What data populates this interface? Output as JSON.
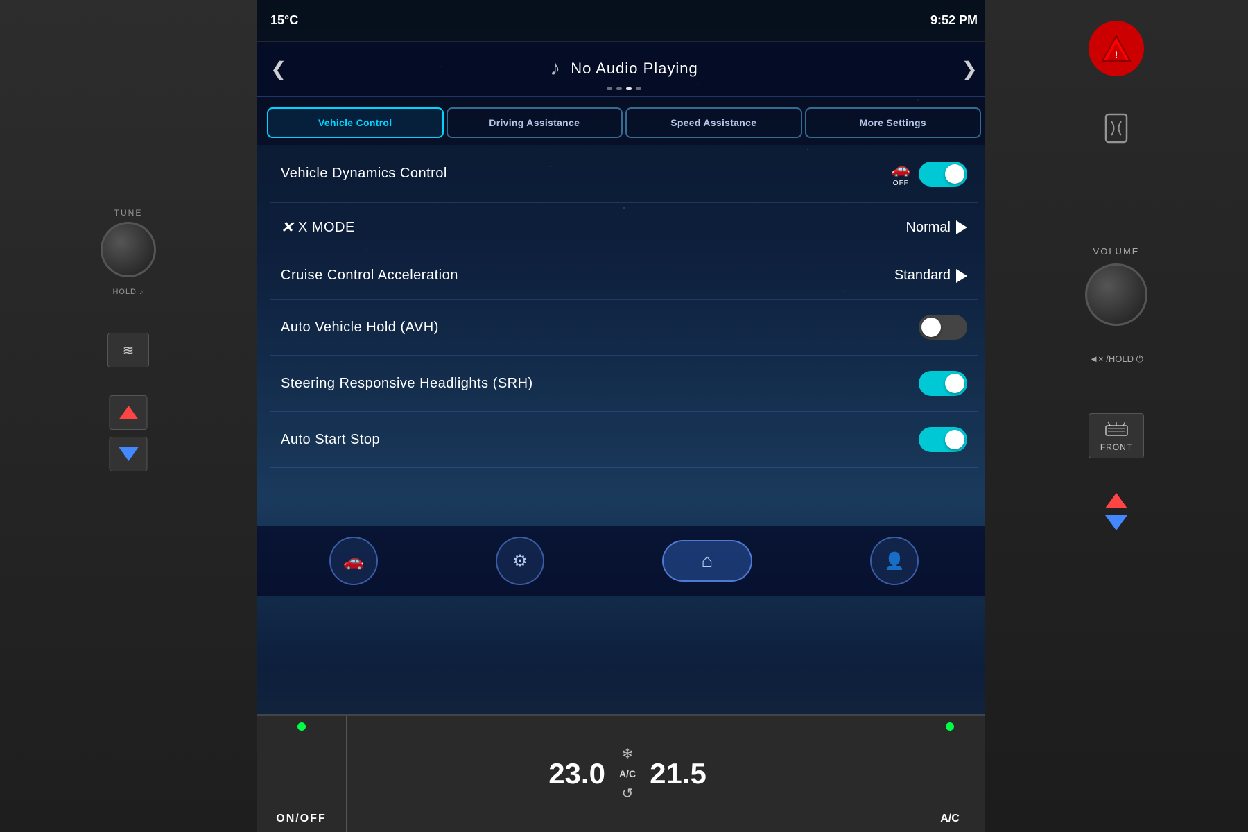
{
  "screen": {
    "status_bar": {
      "temp": "15°C",
      "time": "9:52 PM"
    },
    "audio": {
      "prev_label": "❮",
      "next_label": "❯",
      "title": "No Audio Playing",
      "dots": [
        false,
        false,
        true,
        false
      ]
    },
    "tabs": [
      {
        "id": "vehicle-control",
        "label": "Vehicle Control",
        "active": true
      },
      {
        "id": "driving-assistance",
        "label": "Driving Assistance",
        "active": false
      },
      {
        "id": "speed-assistance",
        "label": "Speed Assistance",
        "active": false
      },
      {
        "id": "more-settings",
        "label": "More Settings",
        "active": false
      }
    ],
    "settings": [
      {
        "id": "vehicle-dynamics-control",
        "label": "Vehicle Dynamics Control",
        "type": "toggle",
        "value": true,
        "has_icon": true
      },
      {
        "id": "xmode",
        "label": "X MODE",
        "type": "selector",
        "value": "Normal",
        "has_xicon": true
      },
      {
        "id": "cruise-control-acceleration",
        "label": "Cruise Control Acceleration",
        "type": "selector",
        "value": "Standard"
      },
      {
        "id": "auto-vehicle-hold",
        "label": "Auto Vehicle Hold (AVH)",
        "type": "toggle",
        "value": false
      },
      {
        "id": "steering-responsive-headlights",
        "label": "Steering Responsive Headlights (SRH)",
        "type": "toggle",
        "value": true
      },
      {
        "id": "auto-start-stop",
        "label": "Auto Start Stop",
        "type": "toggle",
        "value": true
      }
    ],
    "bottom_nav": {
      "car_icon": "🚗",
      "settings_icon": "⚙",
      "home_icon": "⌂",
      "profile_icon": "👤"
    },
    "climate": {
      "onoff_label": "ON/OFF",
      "temp_left": "23.0",
      "ac_label": "A/C",
      "temp_right": "21.5",
      "ac_right_label": "A/C"
    }
  },
  "left_panel": {
    "tune_label": "TUNE",
    "hold_label": "HOLD ♪"
  },
  "right_panel": {
    "volume_label": "VOLUME",
    "mute_label": "◄×/HOLD ⏻",
    "front_label": "FRONT"
  }
}
